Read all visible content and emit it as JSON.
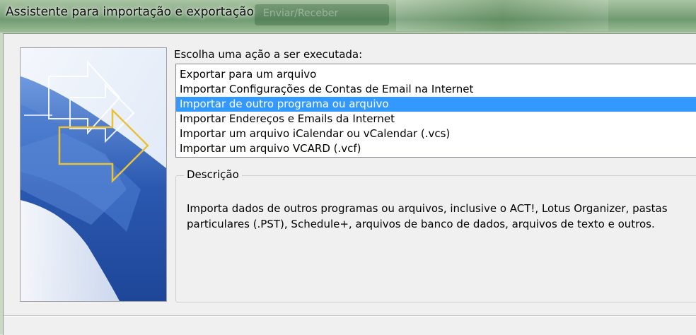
{
  "window": {
    "title": "Assistente para importação e exportação",
    "background_caption": "Enviar/Receber"
  },
  "wizard": {
    "prompt": "Escolha uma ação a ser executada:",
    "actions": [
      "Exportar para um arquivo",
      "Importar Configurações de Contas de Email na Internet",
      "Importar de outro programa ou arquivo",
      "Importar Endereços e Emails da Internet",
      "Importar um arquivo iCalendar ou vCalendar (.vcs)",
      "Importar um arquivo VCARD (.vcf)"
    ],
    "selected_action": "Importar de outro programa ou arquivo",
    "description": {
      "label": "Descrição",
      "text": "Importa dados de outros programas ou arquivos, inclusive o ACT!, Lotus Organizer, pastas particulares (.PST), Schedule+, arquivos de banco de dados, arquivos de texto e outros."
    }
  },
  "colors": {
    "selection": "#3399ff",
    "art_blue": "#2a58b0",
    "arrow_highlight": "#e8c23a"
  },
  "icons": [
    "wizard-banner-arrows-icon"
  ]
}
